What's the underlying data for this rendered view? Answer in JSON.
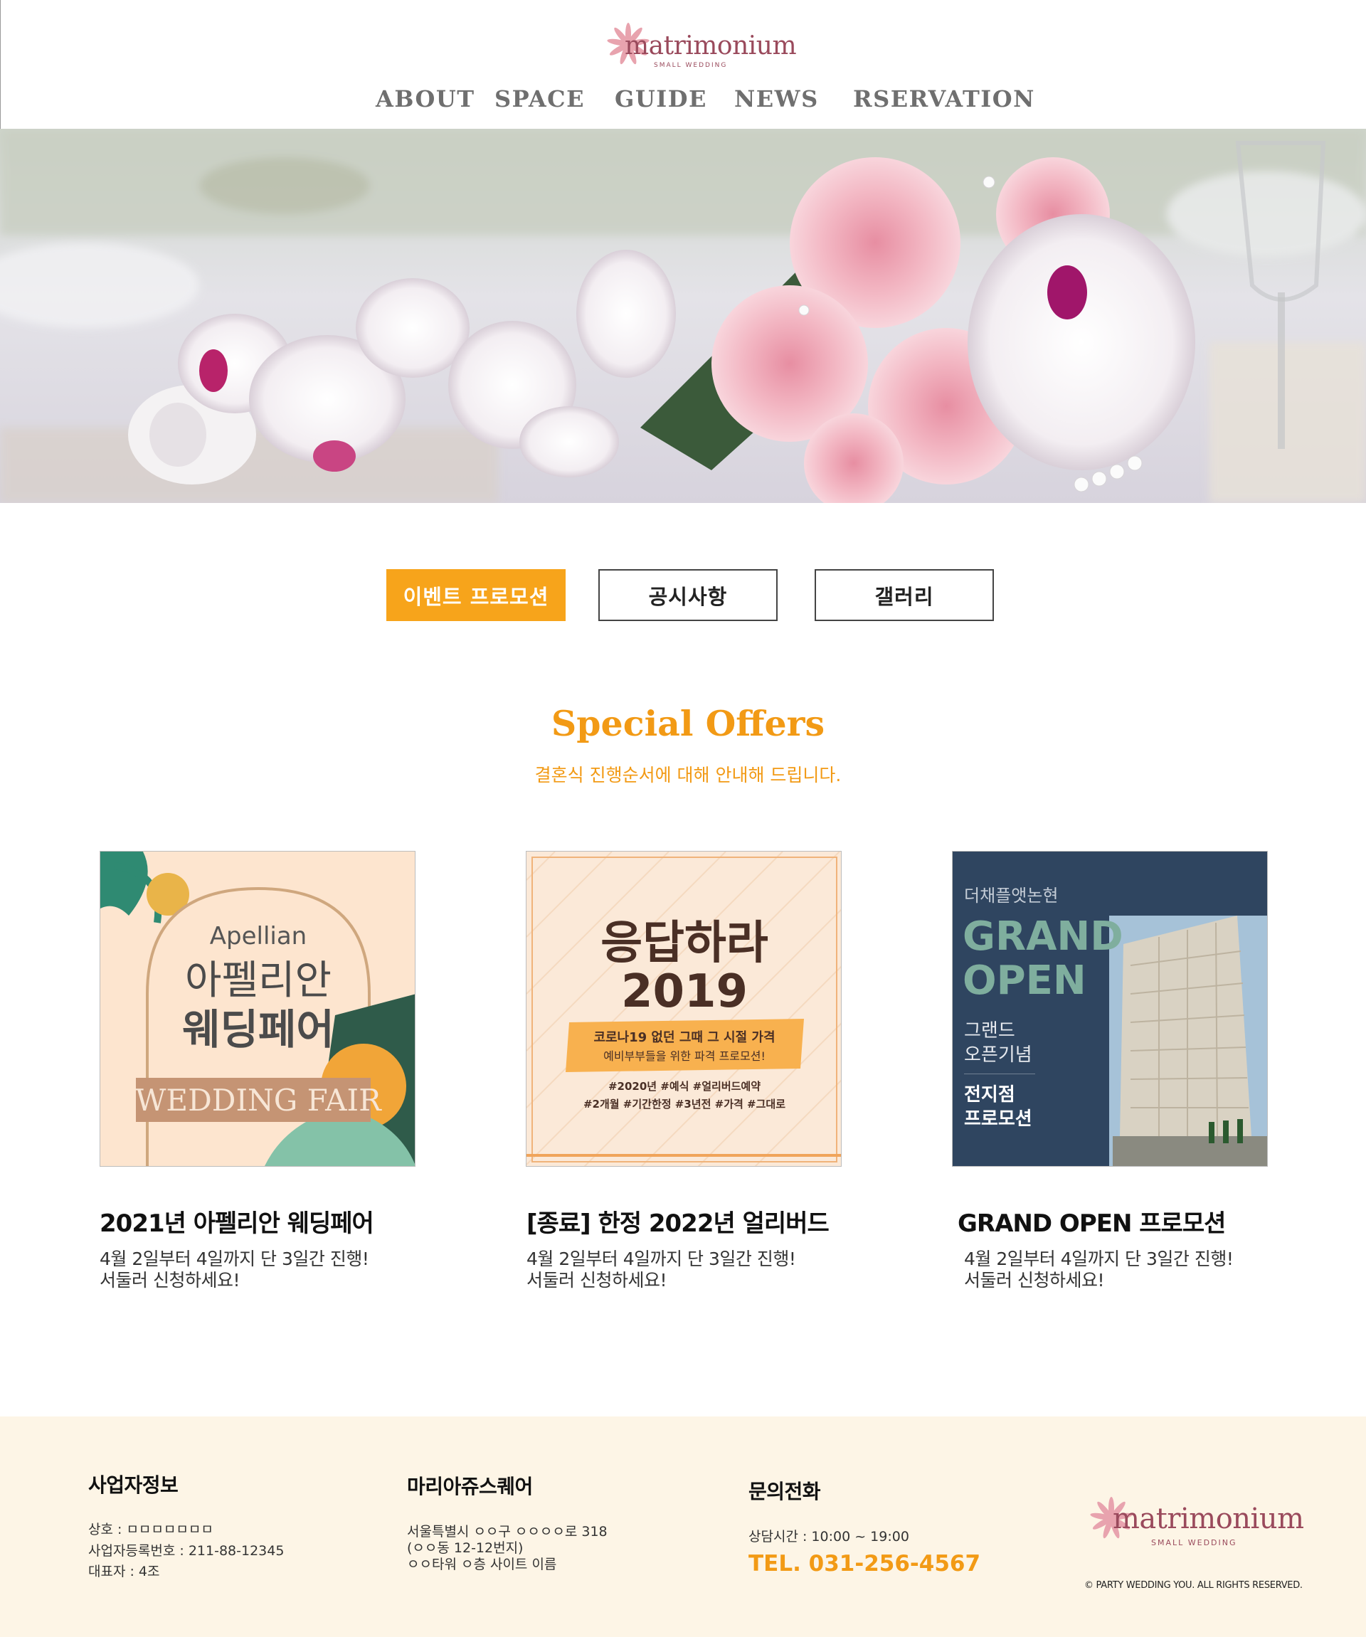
{
  "brand": {
    "name": "matrimonium",
    "tagline": "SMALL WEDDING"
  },
  "nav": [
    "ABOUT",
    "SPACE",
    "GUIDE",
    "NEWS",
    "RSERVATION"
  ],
  "tabs": [
    "이벤트 프로모션",
    "공시사항",
    "갤러리"
  ],
  "section": {
    "title": "Special Offers",
    "subtitle": "결혼식 진행순서에 대해 안내해 드립니다."
  },
  "cards": [
    {
      "title": "2021년 아펠리안 웨딩페어",
      "desc1": "4월 2일부터 4일까지 단 3일간 진행!",
      "desc2": "서둘러 신청하세요!",
      "poster": {
        "line1": "Apellian",
        "line2": "아펠리안",
        "line3": "웨딩페어",
        "line4": "WEDDING FAIR"
      }
    },
    {
      "title": "[종료] 한정 2022년 얼리버드",
      "desc1": "4월 2일부터 4일까지 단 3일간 진행!",
      "desc2": "서둘러 신청하세요!",
      "poster": {
        "line1": "응답하라",
        "line2": "2019",
        "line3": "코로나19 없던 그때 그 시절 가격",
        "line4": "예비부부들을 위한 파격 프로모션!",
        "line5": "#2020년 #예식 #얼리버드예약",
        "line6": "#2개월 #기간한정 #3년전 #가격 #그대로"
      }
    },
    {
      "title": "GRAND OPEN 프로모션",
      "desc1": "4월 2일부터 4일까지 단 3일간 진행!",
      "desc2": "서둘러 신청하세요!",
      "poster": {
        "line1": "더채플앳논현",
        "line2": "GRAND",
        "line3": "OPEN",
        "line4": "그랜드",
        "line5": "오픈기념",
        "line6": "전지점",
        "line7": "프로모션"
      }
    }
  ],
  "footer": {
    "col1": {
      "title": "사업자정보",
      "lines": [
        "상호 : ㅁㅁㅁㅁㅁㅁㅁ",
        "사업자등록번호 : 211-88-12345",
        "대표자 : 4조"
      ]
    },
    "col2": {
      "title": "마리아쥬스퀘어",
      "lines": [
        "서울특별시 ㅇㅇ구 ㅇㅇㅇㅇ로 318",
        "(ㅇㅇ동 12-12번지)",
        "ㅇㅇ타워 ㅇ층 사이트 이름"
      ]
    },
    "col3": {
      "title": "문의전화",
      "hours": "상담시간 : 10:00 ~ 19:00",
      "tel": "TEL. 031-256-4567"
    },
    "copyright": "© PARTY WEDDING YOU. ALL RIGHTS RESERVED."
  },
  "colors": {
    "accent": "#f7a41b",
    "brand": "#9a4a5c",
    "footer_bg": "#fdf5e6"
  }
}
